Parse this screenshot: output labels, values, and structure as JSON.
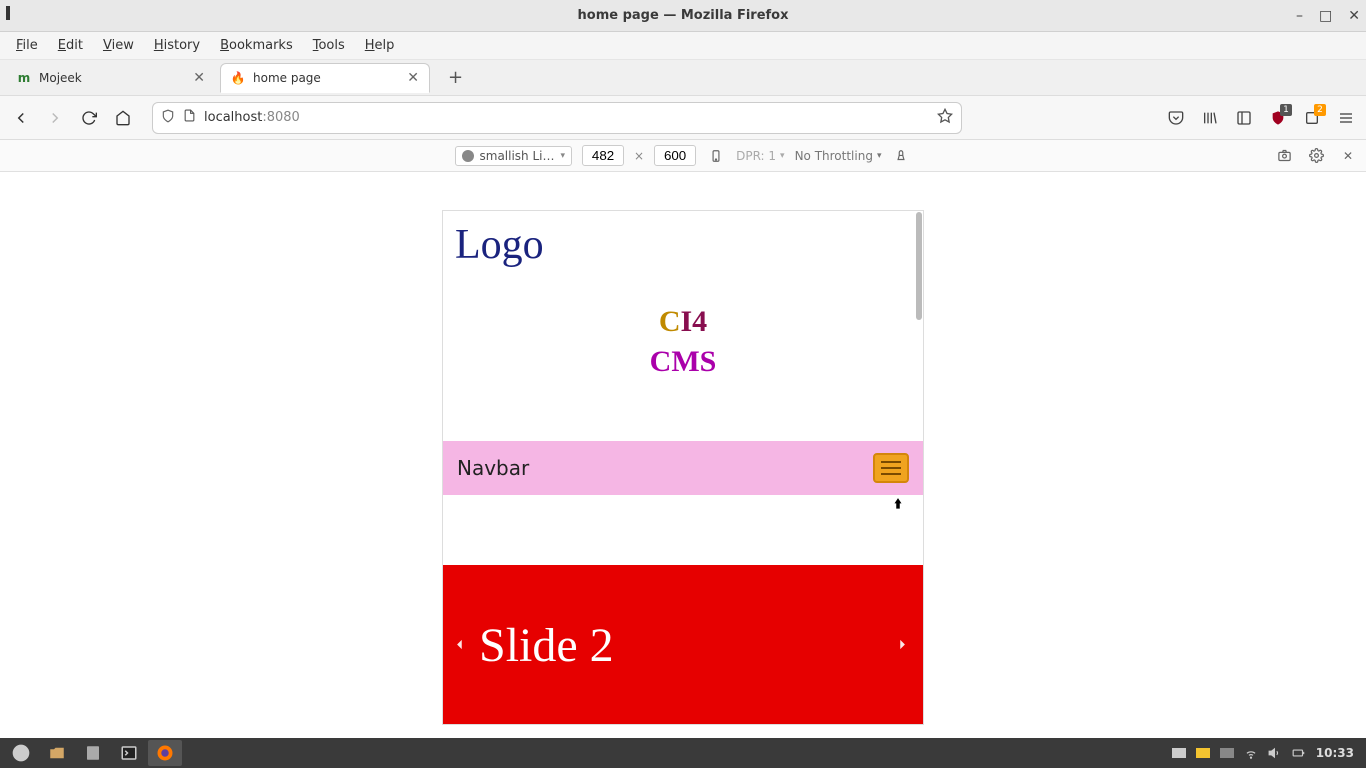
{
  "window": {
    "title": "home page — Mozilla Firefox"
  },
  "menubar": [
    "File",
    "Edit",
    "View",
    "History",
    "Bookmarks",
    "Tools",
    "Help"
  ],
  "tabs": [
    {
      "label": "Mojeek",
      "active": false,
      "favicon_letter": "m",
      "favicon_color": "#2e7d32"
    },
    {
      "label": "home page",
      "active": true,
      "favicon_glyph": "🔥"
    }
  ],
  "url": {
    "host": "localhost",
    "port": ":8080"
  },
  "rdm": {
    "device": "smallish Li…",
    "width": "482",
    "height": "600",
    "dpr": "DPR: 1",
    "throttling": "No Throttling"
  },
  "toolbar_badges": {
    "ublock": "1",
    "ext": "2"
  },
  "page": {
    "logo": "Logo",
    "brand_c": "C",
    "brand_i4": "I4",
    "brand_cms": "CMS",
    "navbar_label": "Navbar",
    "slide_title": "Slide 2"
  },
  "taskbar": {
    "clock": "10:33"
  }
}
